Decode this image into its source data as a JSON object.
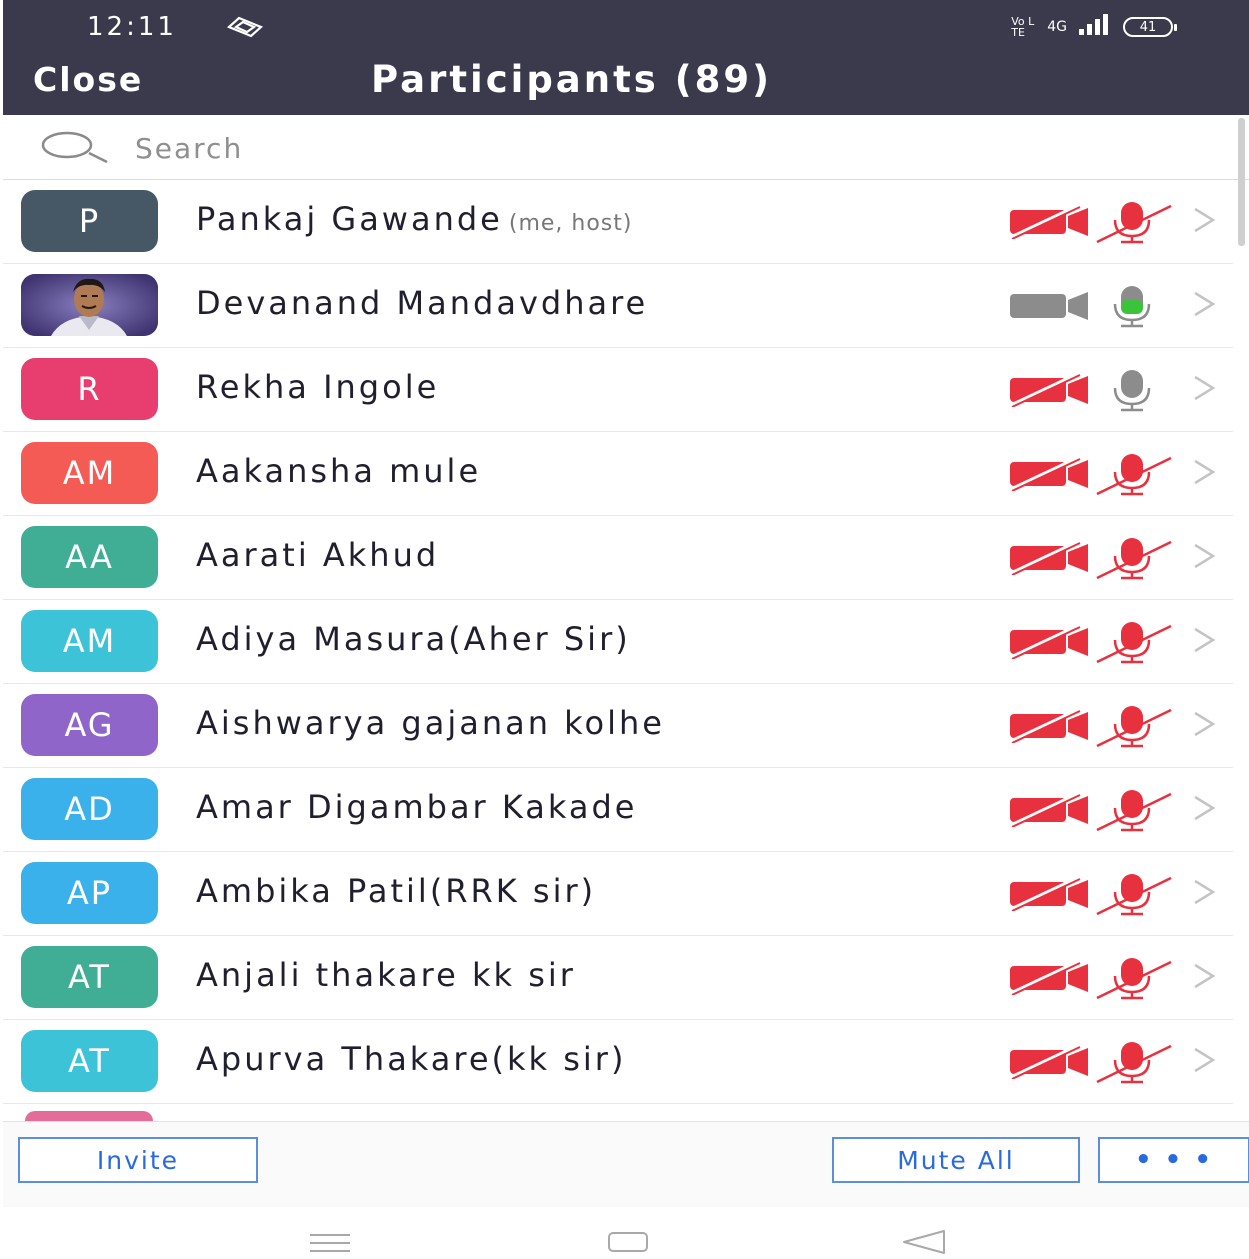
{
  "status_bar": {
    "time": "12:11",
    "network_label": "4G",
    "volte_label": "Vo LTE",
    "battery": "41"
  },
  "header": {
    "close_label": "Close",
    "title": "Participants (89)"
  },
  "search": {
    "placeholder": "Search"
  },
  "participants": [
    {
      "initials": "P",
      "name": "Pankaj Gawande",
      "tag": "(me, host)",
      "color": "#465866",
      "photo": false,
      "video": "off",
      "audio": "muted"
    },
    {
      "initials": "",
      "name": "Devanand Mandavdhare",
      "tag": "",
      "color": "#6a5f9c",
      "photo": true,
      "video": "on",
      "audio": "active"
    },
    {
      "initials": "R",
      "name": "Rekha Ingole",
      "tag": "",
      "color": "#e83d6f",
      "photo": false,
      "video": "off",
      "audio": "unmuted"
    },
    {
      "initials": "AM",
      "name": "Aakansha mule",
      "tag": "",
      "color": "#f35b54",
      "photo": false,
      "video": "off",
      "audio": "muted"
    },
    {
      "initials": "AA",
      "name": "Aarati Akhud",
      "tag": "",
      "color": "#3fae94",
      "photo": false,
      "video": "off",
      "audio": "muted"
    },
    {
      "initials": "AM",
      "name": "Adiya Masura(Aher Sir)",
      "tag": "",
      "color": "#3cc3d8",
      "photo": false,
      "video": "off",
      "audio": "muted"
    },
    {
      "initials": "AG",
      "name": "Aishwarya gajanan kolhe",
      "tag": "",
      "color": "#8f65c9",
      "photo": false,
      "video": "off",
      "audio": "muted"
    },
    {
      "initials": "AD",
      "name": "Amar Digambar Kakade",
      "tag": "",
      "color": "#3ab1ea",
      "photo": false,
      "video": "off",
      "audio": "muted"
    },
    {
      "initials": "AP",
      "name": "Ambika Patil(RRK sir)",
      "tag": "",
      "color": "#3ab1ea",
      "photo": false,
      "video": "off",
      "audio": "muted"
    },
    {
      "initials": "AT",
      "name": "Anjali thakare kk sir",
      "tag": "",
      "color": "#3fae94",
      "photo": false,
      "video": "off",
      "audio": "muted"
    },
    {
      "initials": "AT",
      "name": "Apurva Thakare(kk sir)",
      "tag": "",
      "color": "#3cc3d8",
      "photo": false,
      "video": "off",
      "audio": "muted"
    }
  ],
  "footer": {
    "invite_label": "Invite",
    "mute_all_label": "Mute All",
    "more_label": "• • •"
  },
  "colors": {
    "header_bg": "#3a3a4c",
    "muted_red": "#e8313f",
    "accent_blue": "#2a6ae0",
    "speaking_green": "#3cc33c"
  }
}
